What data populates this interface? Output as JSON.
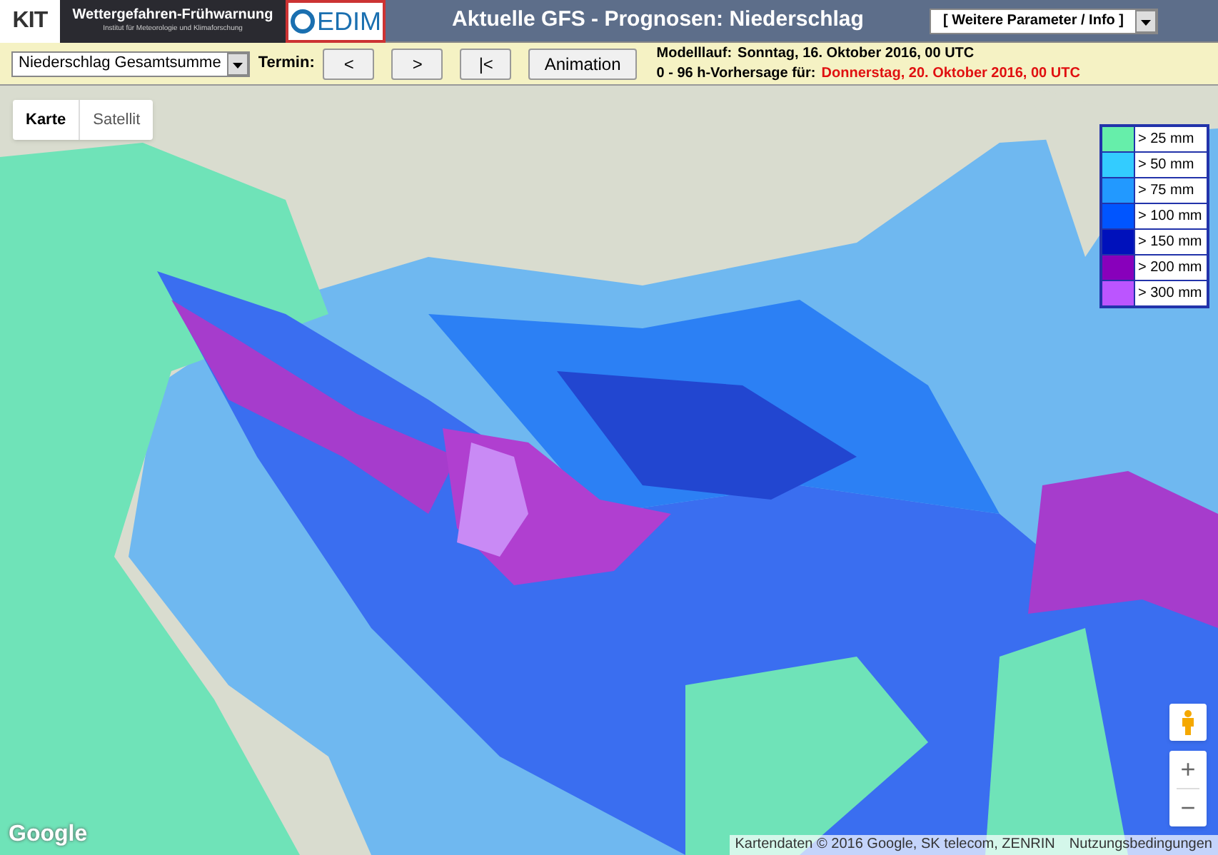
{
  "header": {
    "kit_logo": "KIT",
    "banner_title": "Wettergefahren-Frühwarnung",
    "banner_subtitle": "Institut für Meteorologie und Klimaforschung",
    "cedim_logo": "EDIM",
    "title": "Aktuelle GFS - Prognosen: Niederschlag",
    "menu": "[ Weitere Parameter / Info ]"
  },
  "toolbar": {
    "parameter": "Niederschlag Gesamtsumme",
    "termin_label": "Termin:",
    "buttons": [
      "<",
      ">",
      "|<",
      "Animation"
    ],
    "model_run_label": "Modelllauf:",
    "model_run": "Sonntag, 16. Oktober 2016, 00 UTC",
    "forecast_label": "0 - 96 h-Vorhersage für:",
    "forecast": "Donnerstag, 20. Oktober 2016, 00 UTC"
  },
  "map": {
    "map_type_tabs": [
      {
        "label": "Karte",
        "selected": true
      },
      {
        "label": "Satellit",
        "selected": false
      }
    ],
    "legend": [
      {
        "label": "> 25 mm",
        "color": "#66eeaa"
      },
      {
        "label": "> 50 mm",
        "color": "#33ccff"
      },
      {
        "label": "> 75 mm",
        "color": "#2299ff"
      },
      {
        "label": "> 100 mm",
        "color": "#0055ff"
      },
      {
        "label": "> 150 mm",
        "color": "#0011bb"
      },
      {
        "label": "> 200 mm",
        "color": "#8800bb"
      },
      {
        "label": "> 300 mm",
        "color": "#bb55ff"
      }
    ],
    "zoom_in": "+",
    "zoom_out": "−",
    "google_logo": "Google",
    "attribution": "Kartendaten © 2016 Google, SK telecom, ZENRIN",
    "terms": "Nutzungsbedingungen"
  }
}
